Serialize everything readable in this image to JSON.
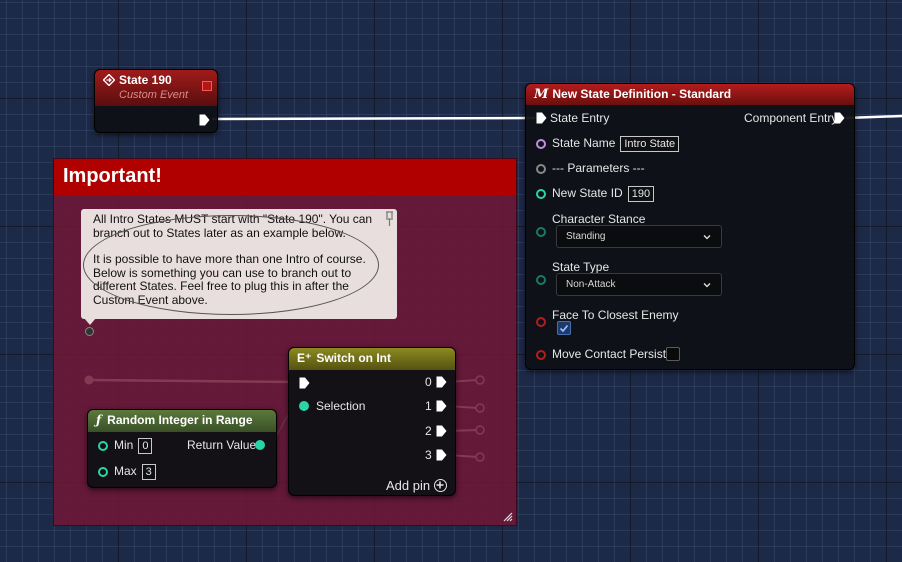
{
  "event_node": {
    "title": "State 190",
    "subtitle": "Custom Event"
  },
  "comment": {
    "title": "Important!"
  },
  "note": {
    "lines_a": [
      "All Intro States MUST start with \"State 190\". You can",
      "branch out to States later as an example below."
    ],
    "lines_b": [
      "It is possible to have more than one Intro of course.",
      "Below is something you can use to branch out to",
      "different States. Feel free to plug this in after the",
      "Custom Event above."
    ]
  },
  "random_node": {
    "title": "Random Integer in Range",
    "min_label": "Min",
    "min_value": "0",
    "max_label": "Max",
    "max_value": "3",
    "return_label": "Return Value"
  },
  "switch_node": {
    "title": "Switch on Int",
    "selection_label": "Selection",
    "outputs": [
      "0",
      "1",
      "2",
      "3"
    ],
    "add_pin_label": "Add pin"
  },
  "state_node": {
    "title": "New State Definition - Standard",
    "icon_letter": "M",
    "state_entry": "State Entry",
    "component_entry": "Component Entry",
    "state_name_label": "State Name",
    "state_name_value": "Intro State",
    "parameters_label": "--- Parameters ---",
    "new_state_id_label": "New State ID",
    "new_state_id_value": "190",
    "character_stance_label": "Character Stance",
    "character_stance_value": "Standing",
    "state_type_label": "State Type",
    "state_type_value": "Non-Attack",
    "face_closest_label": "Face To Closest Enemy",
    "face_closest_checked": true,
    "move_contact_label": "Move Contact Persist",
    "move_contact_checked": false
  },
  "colors": {
    "background": "#1d2a47",
    "comment_header": "#b00000",
    "comment_body": "#711636",
    "event_header": "#a01b1b",
    "function_header": "#5b7a3c",
    "switch_header": "#8c8a20",
    "state_header": "#b41c1c",
    "int_pin": "#2ad4a8",
    "string_pin": "#c48ee0",
    "bool_pin": "#b21e1e"
  }
}
